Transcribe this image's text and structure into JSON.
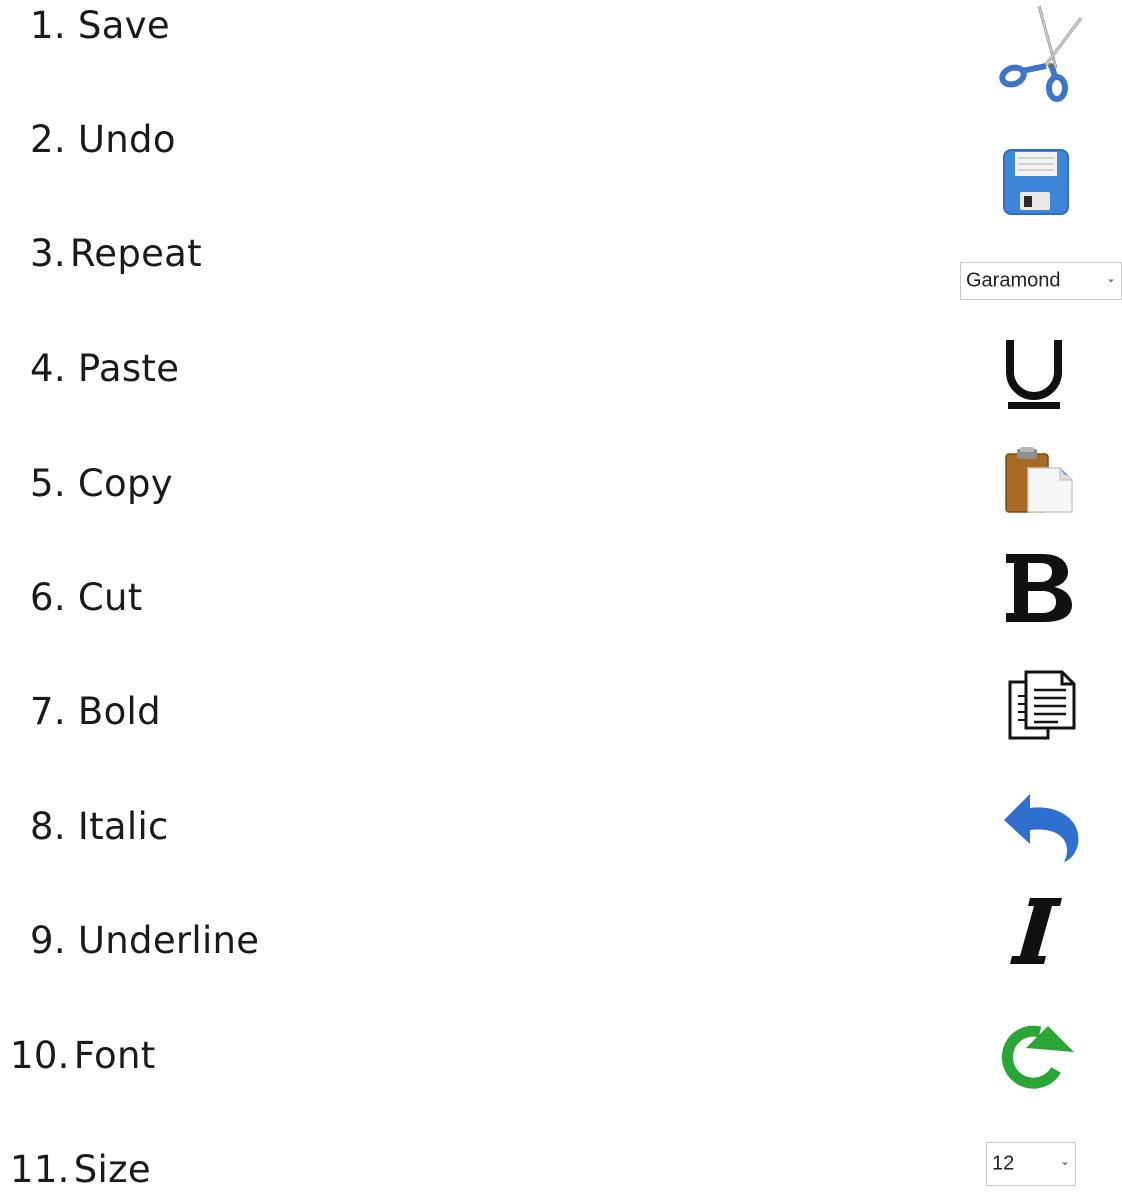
{
  "terms": [
    {
      "num": "1.",
      "label": "Save"
    },
    {
      "num": "2.",
      "label": "Undo"
    },
    {
      "num": "3.",
      "label": "Repeat"
    },
    {
      "num": "4.",
      "label": "Paste"
    },
    {
      "num": "5.",
      "label": "Copy"
    },
    {
      "num": "6.",
      "label": "Cut"
    },
    {
      "num": "7.",
      "label": "Bold"
    },
    {
      "num": "8.",
      "label": "Italic"
    },
    {
      "num": "9.",
      "label": "Underline"
    },
    {
      "num": "10.",
      "label": "Font"
    },
    {
      "num": "11.",
      "label": "Size"
    }
  ],
  "icons": {
    "scissors": "scissors-icon",
    "save": "floppy-disk-icon",
    "font_box": {
      "value": "Garamond"
    },
    "underline": {
      "glyph": "U"
    },
    "paste": "clipboard-icon",
    "bold": {
      "glyph": "B"
    },
    "copy": "document-copy-icon",
    "undo": "undo-arrow-icon",
    "italic": {
      "glyph": "I"
    },
    "repeat": "redo-arrow-icon",
    "size_box": {
      "value": "12"
    }
  },
  "colors": {
    "scissors_blue": "#3f74c9",
    "floppy_blue": "#3d86d8",
    "undo_blue": "#2f6fd0",
    "redo_green": "#2aa637",
    "clipboard_brown": "#a86a23"
  }
}
